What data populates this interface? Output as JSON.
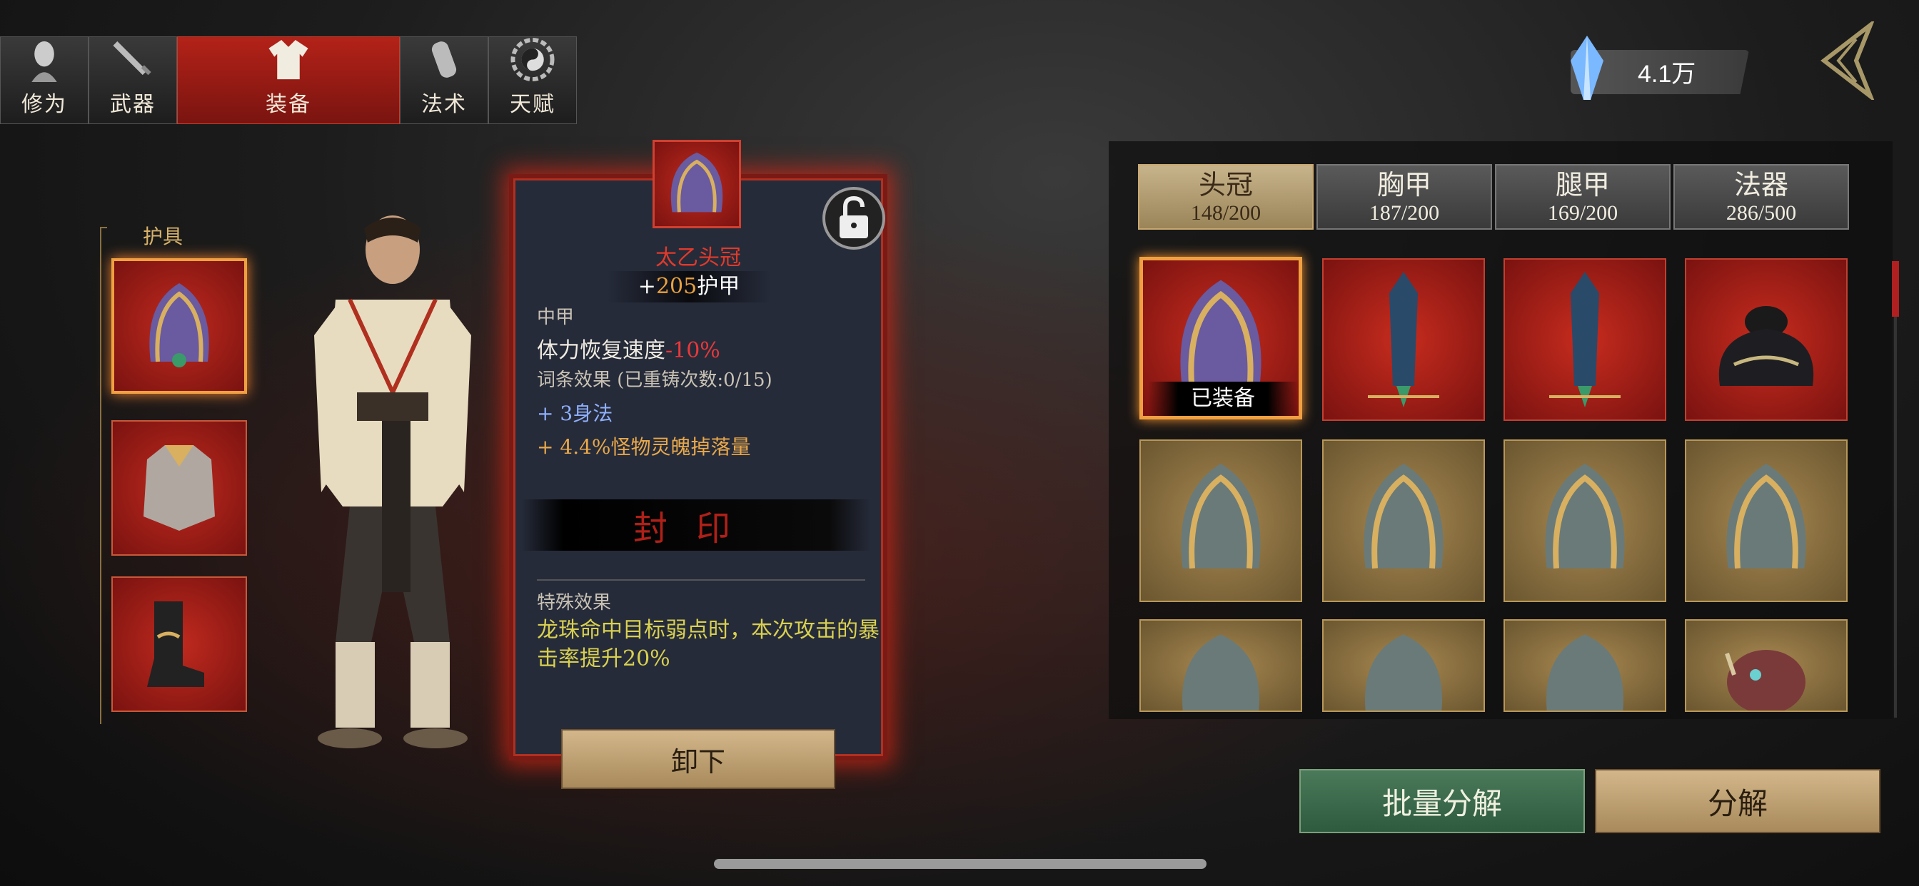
{
  "top_tabs": [
    {
      "label": "修为",
      "icon": "meditation-head-icon"
    },
    {
      "label": "武器",
      "icon": "sword-icon"
    },
    {
      "label": "装备",
      "icon": "robe-icon",
      "active": true
    },
    {
      "label": "法术",
      "icon": "scroll-gourd-icon"
    },
    {
      "label": "天赋",
      "icon": "bagua-icon"
    }
  ],
  "currency": {
    "value": "4.1万",
    "icon": "spirit-crystal-icon"
  },
  "slots": {
    "title": "护具",
    "items": [
      "helmet",
      "chest-armor",
      "boots"
    ]
  },
  "detail": {
    "name": "太乙头冠",
    "armor_prefix": "+",
    "armor_value": "205",
    "armor_label": "护甲",
    "weight": "中甲",
    "stat_label": "体力恢复速度",
    "stat_value": "-10%",
    "affix_header": "词条效果 (已重铸次数:0/15)",
    "affixes": [
      {
        "prefix": "+ ",
        "value": "3",
        "label": "身法",
        "color": "blue"
      },
      {
        "prefix": "+ ",
        "value": "4.4%",
        "label": "怪物灵魄掉落量",
        "color": "gold"
      }
    ],
    "seal_text": "封印",
    "special_header": "特殊效果",
    "special_text": "龙珠命中目标弱点时，本次攻击的暴击率提升20%",
    "unequip_label": "卸下"
  },
  "category_tabs": [
    {
      "name": "头冠",
      "count": "148/200",
      "active": true
    },
    {
      "name": "胸甲",
      "count": "187/200"
    },
    {
      "name": "腿甲",
      "count": "169/200"
    },
    {
      "name": "法器",
      "count": "286/500"
    }
  ],
  "equipped_label": "已装备",
  "bulk_decompose_label": "批量分解",
  "decompose_label": "分解",
  "colors": {
    "accent_red": "#c82c1e",
    "gold": "#e8a84a",
    "selection": "#f0a040"
  }
}
